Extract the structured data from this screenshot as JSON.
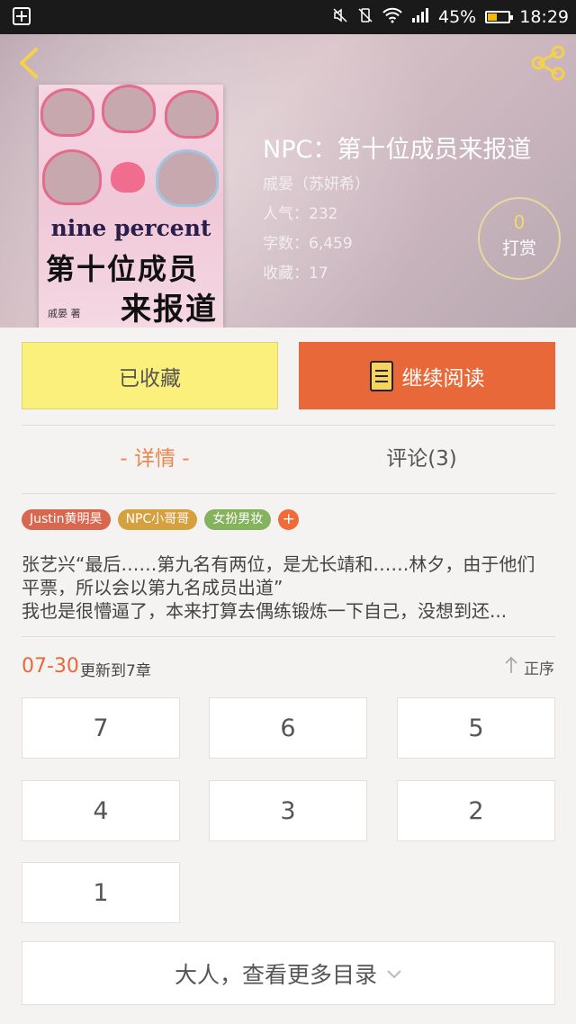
{
  "status_bar": {
    "battery": "45%",
    "battery_level": 0.45,
    "time": "18:29",
    "icons": [
      "mute-icon",
      "vibrate-off-icon",
      "wifi-icon",
      "signal-icon",
      "battery-icon"
    ]
  },
  "header": {
    "back_icon": "chevron-left-icon",
    "share_icon": "share-icon"
  },
  "book": {
    "title": "NPC：第十位成员来报道",
    "author": "戚晏（苏妍希）",
    "popularity": "人气：232",
    "word_count": "字数：6,459",
    "favorites": "收藏：17",
    "cover": {
      "line1": "nine percent",
      "line2": "第十位成员",
      "line3": "来报道",
      "author_mark": "戚晏 著"
    }
  },
  "tip": {
    "count": "0",
    "label": "打赏"
  },
  "actions": {
    "favorited_label": "已收藏",
    "continue_label": "继续阅读"
  },
  "tabs": {
    "detail": "- 详情 -",
    "comments": "评论(3)"
  },
  "tags": [
    {
      "label": "Justin黄明昊",
      "color": "#d8674f"
    },
    {
      "label": "NPC小哥哥",
      "color": "#d5a13e"
    },
    {
      "label": "女扮男妆",
      "color": "#85b25c"
    }
  ],
  "tag_add": "+",
  "summary": {
    "line1": "张艺兴“最后……第九名有两位，是尤长靖和……林夕，由于他们",
    "line2": "平票，所以会以第九名成员出道”",
    "line3": "我也是很懵逼了，本来打算去偶练锻炼一下自己，没想到还..."
  },
  "update": {
    "date": "07-30",
    "text": "更新到7章",
    "sort_label": "正序"
  },
  "chapters": [
    "7",
    "6",
    "5",
    "4",
    "3",
    "2",
    "1"
  ],
  "more_label": "大人，查看更多目录"
}
